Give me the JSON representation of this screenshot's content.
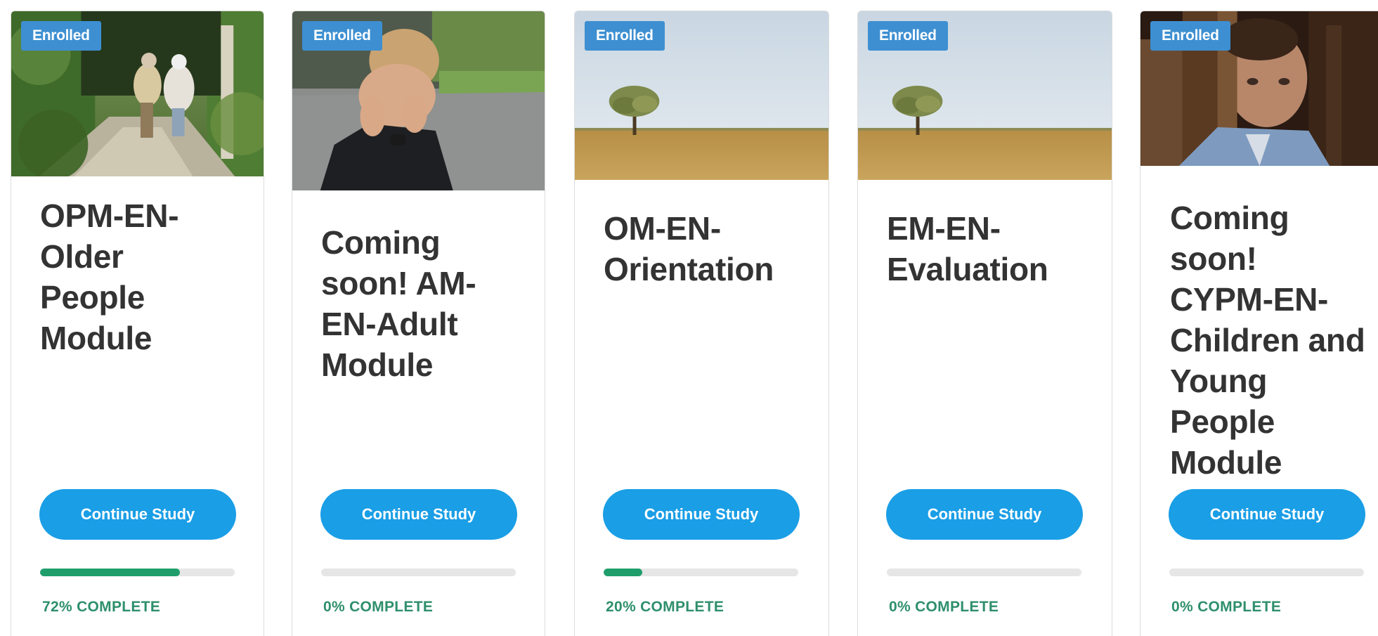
{
  "colors": {
    "badge": "#3d8fd1",
    "button": "#1a9ee6",
    "progress_fill": "#1f9e6b",
    "progress_track": "#e6e6e6",
    "progress_text": "#2e8f6c",
    "title": "#333333"
  },
  "courses": [
    {
      "badge": "Enrolled",
      "title": "OPM-EN-Older People Module",
      "title_lines": [
        "OPM-EN-",
        "Older",
        "People",
        "Module"
      ],
      "button": "Continue Study",
      "progress": 72,
      "progress_text": "72% COMPLETE",
      "image": "older-couple-walking-photo"
    },
    {
      "badge": "Enrolled",
      "title": "Coming soon! AM-EN-Adult Module",
      "title_lines": [
        "Coming",
        "soon! AM-",
        "EN-Adult",
        "Module"
      ],
      "button": "Continue Study",
      "progress": 0,
      "progress_text": "0% COMPLETE",
      "image": "distressed-woman-photo"
    },
    {
      "badge": "Enrolled",
      "title": "OM-EN-Orientation",
      "title_lines": [
        "OM-EN-",
        "Orientation"
      ],
      "button": "Continue Study",
      "progress": 20,
      "progress_text": "20% COMPLETE",
      "image": "lone-tree-field-photo"
    },
    {
      "badge": "Enrolled",
      "title": "EM-EN-Evaluation",
      "title_lines": [
        "EM-EN-",
        "Evaluation"
      ],
      "button": "Continue Study",
      "progress": 0,
      "progress_text": "0% COMPLETE",
      "image": "lone-tree-field-photo"
    },
    {
      "badge": "Enrolled",
      "title": "Coming soon! CYPM-EN-Children and Young People Module",
      "title_lines": [
        "Coming",
        "soon!",
        "CYPM-EN-",
        "Children and",
        "Young",
        "People",
        "Module"
      ],
      "button": "Continue Study",
      "progress": 0,
      "progress_text": "0% COMPLETE",
      "image": "sad-child-behind-door-photo"
    }
  ]
}
